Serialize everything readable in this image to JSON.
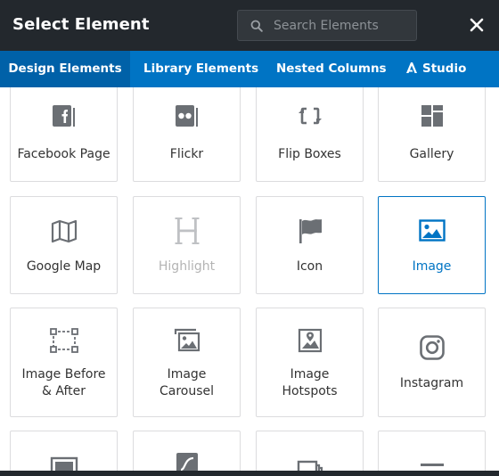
{
  "header": {
    "title": "Select Element",
    "search_placeholder": "Search Elements",
    "search_value": ""
  },
  "tabs": [
    {
      "label": "Design Elements",
      "active": true
    },
    {
      "label": "Library Elements",
      "active": false
    },
    {
      "label": "Nested Columns",
      "active": false
    },
    {
      "label": "Studio",
      "active": false,
      "icon": "studio-icon"
    }
  ],
  "elements": [
    {
      "label": "Facebook Page",
      "icon": "facebook-page-icon"
    },
    {
      "label": "Flickr",
      "icon": "flickr-icon"
    },
    {
      "label": "Flip Boxes",
      "icon": "flip-boxes-icon"
    },
    {
      "label": "Gallery",
      "icon": "gallery-icon"
    },
    {
      "label": "Google Map",
      "icon": "google-map-icon"
    },
    {
      "label": "Highlight",
      "icon": "highlight-icon",
      "state": "disabled"
    },
    {
      "label": "Icon",
      "icon": "flag-icon"
    },
    {
      "label": "Image",
      "icon": "image-icon",
      "state": "selected"
    },
    {
      "label": "Image Before\n& After",
      "icon": "image-before-after-icon"
    },
    {
      "label": "Image\nCarousel",
      "icon": "image-carousel-icon"
    },
    {
      "label": "Image\nHotspots",
      "icon": "image-hotspots-icon"
    },
    {
      "label": "Instagram",
      "icon": "instagram-icon"
    }
  ],
  "colors": {
    "header_bg": "#23282d",
    "tab_bg": "#0074c4",
    "tab_active_bg": "#0061a8",
    "accent": "#0074c4",
    "icon": "#6b6f74"
  }
}
